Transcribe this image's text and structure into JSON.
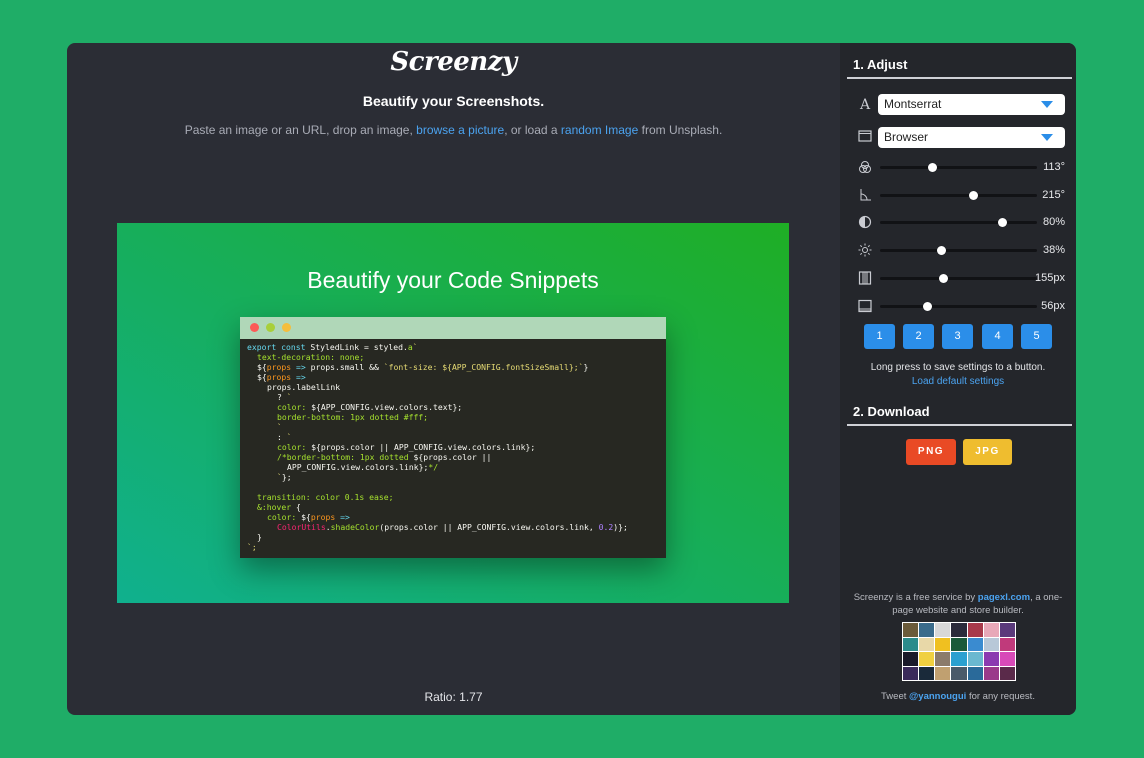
{
  "app": {
    "logo": "Screenzy",
    "tagline": "Beautify your Screenshots."
  },
  "intro": {
    "text_before": "Paste an image or an URL, drop an image, ",
    "link_browse": "browse a picture",
    "text_middle": ", or load a ",
    "link_random": "random Image",
    "text_after": " from Unsplash."
  },
  "preview": {
    "title": "Beautify your Code Snippets",
    "ratio": "Ratio: 1.77"
  },
  "sidebar": {
    "adjust_title": "1. Adjust",
    "font_select": "Montserrat",
    "frame_select": "Browser",
    "sliders": [
      {
        "icon": "palette-icon",
        "value_label": "113°",
        "fraction": 0.33
      },
      {
        "icon": "angle-icon",
        "value_label": "215°",
        "fraction": 0.59
      },
      {
        "icon": "contrast-icon",
        "value_label": "80%",
        "fraction": 0.78
      },
      {
        "icon": "brightness-icon",
        "value_label": "38%",
        "fraction": 0.39
      },
      {
        "icon": "padding-icon",
        "value_label": "155px",
        "fraction": 0.4
      },
      {
        "icon": "margin-icon",
        "value_label": "56px",
        "fraction": 0.3
      }
    ],
    "presets": [
      "1",
      "2",
      "3",
      "4",
      "5"
    ],
    "presets_note": "Long press to save settings to a button.",
    "load_defaults": "Load default settings",
    "download_title": "2. Download",
    "png_label": "PNG",
    "jpg_label": "JPG",
    "footer_before": "Screenzy is a free service by ",
    "footer_link": "pagexl.com",
    "footer_after": ", a one-page website and store builder.",
    "tweet_before": "Tweet ",
    "tweet_link": "@yannougui",
    "tweet_after": " for any request."
  },
  "colors": {
    "background": "#1fad67",
    "accent_blue": "#2b8ee9",
    "png_button": "#e94a25",
    "jpg_button": "#efbd2f"
  }
}
